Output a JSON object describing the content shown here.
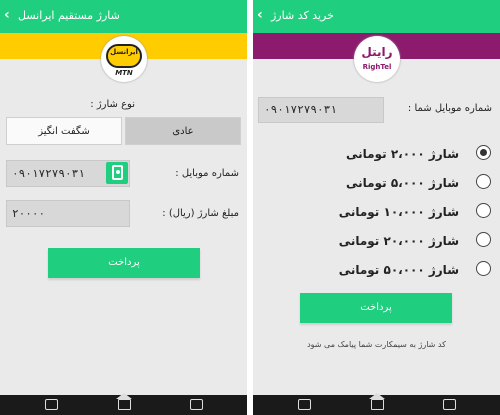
{
  "left": {
    "title": "شارژ مستقیم ایرانسل",
    "back_icon": "chevron-left-icon",
    "brand_color": "#ffcc00",
    "logo_text_fa": "ایرانسل",
    "logo_text_en": "MTN",
    "charge_type_label": "نوع شارژ :",
    "type_options": [
      "شگفت انگیز",
      "عادی"
    ],
    "selected_type": "عادی",
    "mobile_label": "شماره موبایل :",
    "mobile_value": "۰۹۰۱۷۲۷۹۰۳۱",
    "contact_icon": "contact-book-icon",
    "amount_label": "مبلغ شارژ (ریال) :",
    "amount_value": "۲۰۰۰۰",
    "pay_button": "پرداخت"
  },
  "right": {
    "title": "خرید کد شارژ",
    "back_icon": "chevron-left-icon",
    "brand_color": "#8c1a6d",
    "logo_text_fa": "رایتل",
    "logo_text_en": "RighTel",
    "mobile_label": "شماره موبایل شما :",
    "mobile_value": "۰۹۰۱۷۲۷۹۰۳۱",
    "options": [
      {
        "label": "شارژ ۲،۰۰۰ تومانی",
        "selected": true
      },
      {
        "label": "شارژ ۵،۰۰۰ تومانی",
        "selected": false
      },
      {
        "label": "شارژ ۱۰،۰۰۰ تومانی",
        "selected": false
      },
      {
        "label": "شارژ ۲۰،۰۰۰ تومانی",
        "selected": false
      },
      {
        "label": "شارژ ۵۰،۰۰۰ تومانی",
        "selected": false
      }
    ],
    "pay_button": "پرداخت",
    "note": "کد شارژ به سیمکارت شما پیامک می شود"
  },
  "accent_color": "#1fcf7f",
  "navbar_icons": [
    "back-icon",
    "home-icon",
    "recent-apps-icon"
  ]
}
